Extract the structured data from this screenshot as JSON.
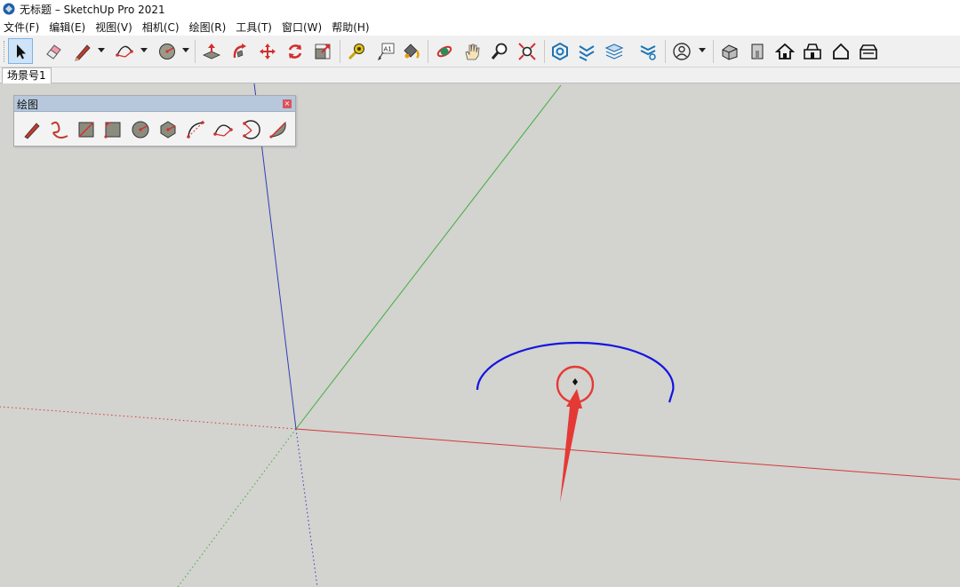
{
  "window": {
    "title": "无标题 – SketchUp Pro 2021"
  },
  "menu": [
    "文件(F)",
    "编辑(E)",
    "视图(V)",
    "相机(C)",
    "绘图(R)",
    "工具(T)",
    "窗口(W)",
    "帮助(H)"
  ],
  "toolbar": {
    "tools": [
      "select-tool",
      "eraser-tool",
      "line-tool",
      "arc-tool",
      "circle-tool",
      "push-pull-tool",
      "follow-me-tool",
      "move-tool",
      "rotate-tool",
      "scale-tool",
      "tape-measure-tool",
      "text-tool",
      "paint-bucket-tool",
      "orbit-tool",
      "pan-tool",
      "zoom-tool",
      "zoom-extents-tool",
      "component-tool",
      "sandbox-tool",
      "layer-tool",
      "style-tool",
      "account-tool",
      "iso-view",
      "front-view",
      "top-view",
      "right-view",
      "back-view",
      "left-view"
    ],
    "active_tool": "select-tool"
  },
  "scene_tab": {
    "label": "场景号1"
  },
  "palette": {
    "title": "绘图",
    "tools": [
      "line-tool",
      "freehand-tool",
      "rectangle-tool",
      "rotated-rectangle-tool",
      "circle-tool",
      "polygon-tool",
      "arc-tool",
      "two-point-arc-tool",
      "three-point-arc-tool",
      "pie-tool"
    ]
  },
  "viewport": {
    "axis_colors": {
      "red": "#d23b3b",
      "green": "#3fae3f",
      "blue": "#2f3fb8"
    },
    "arc_color": "#1515e0",
    "highlight_color": "#e53935"
  }
}
